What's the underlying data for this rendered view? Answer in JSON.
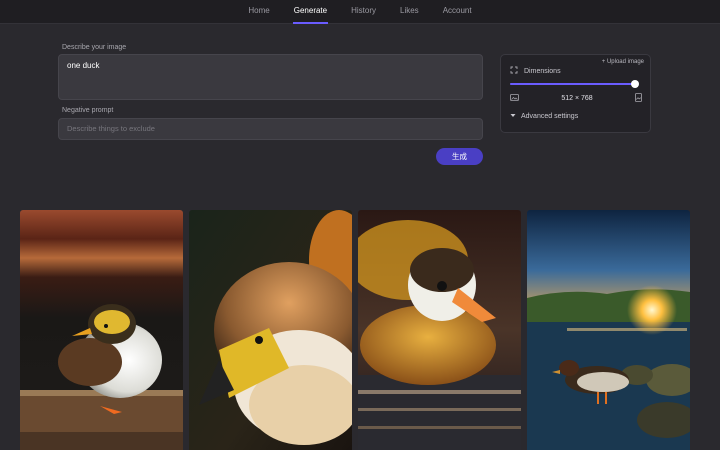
{
  "nav": {
    "items": [
      {
        "label": "Home"
      },
      {
        "label": "Generate",
        "active": true
      },
      {
        "label": "History"
      },
      {
        "label": "Likes"
      },
      {
        "label": "Account"
      }
    ]
  },
  "form": {
    "prompt_label": "Describe your image",
    "prompt_value": "one duck",
    "negative_label": "Negative prompt",
    "negative_placeholder": "Describe things to exclude",
    "generate_label": "生成"
  },
  "settings": {
    "upload_label": "+ Upload image",
    "dimensions_label": "Dimensions",
    "size_text": "512 × 768",
    "slider_fraction": 0.98,
    "advanced_label": "Advanced settings"
  },
  "gallery": {
    "images": [
      {
        "subject": "duck-on-wood-sunset"
      },
      {
        "subject": "duck-closeup-portrait"
      },
      {
        "subject": "duck-on-water-golden"
      },
      {
        "subject": "duck-by-lake-sunrise"
      }
    ]
  },
  "colors": {
    "accent": "#6a5cff",
    "button": "#4a3fc4",
    "background": "#2a292e"
  }
}
